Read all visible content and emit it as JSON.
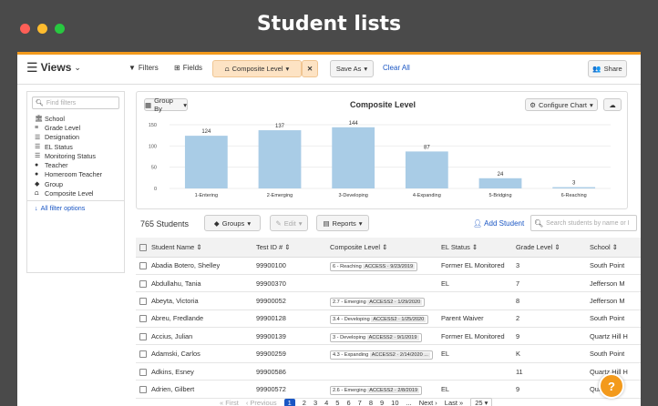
{
  "window": {
    "title": "Student lists",
    "dots": [
      "#ff5f57",
      "#febc2e",
      "#28c840"
    ],
    "accent": "#f39a1c"
  },
  "toolbar": {
    "views_label": "Views",
    "filters_label": "Filters",
    "fields_label": "Fields",
    "active_filter_label": "Composite Level",
    "save_as_label": "Save As",
    "clear_all_label": "Clear All",
    "share_label": "Share"
  },
  "sidebar": {
    "search_placeholder": "Find filters",
    "items": [
      {
        "label": "School",
        "icon": "building-icon"
      },
      {
        "label": "Grade Level",
        "icon": "bars-icon"
      },
      {
        "label": "Designation",
        "icon": "list-icon"
      },
      {
        "label": "EL Status",
        "icon": "list-icon"
      },
      {
        "label": "Monitoring Status",
        "icon": "list-icon"
      },
      {
        "label": "Teacher",
        "icon": "person-icon"
      },
      {
        "label": "Homeroom Teacher",
        "icon": "person-icon"
      },
      {
        "label": "Group",
        "icon": "tag-icon"
      },
      {
        "label": "Composite Level",
        "icon": "chart-icon"
      }
    ],
    "all_filters_label": "All filter options"
  },
  "chart_panel": {
    "group_by_label": "Group By",
    "configure_label": "Configure Chart"
  },
  "chart_data": {
    "type": "bar",
    "title": "Composite Level",
    "categories": [
      "1-Entering",
      "2-Emerging",
      "3-Developing",
      "4-Expanding",
      "5-Bridging",
      "6-Reaching"
    ],
    "values": [
      124,
      137,
      144,
      87,
      24,
      3
    ],
    "ylim": [
      0,
      150
    ],
    "yticks": [
      0,
      50,
      100,
      150
    ],
    "bar_color": "#a9cce6",
    "grid": true,
    "xlabel": "",
    "ylabel": ""
  },
  "list": {
    "count_label": "765 Students",
    "groups_label": "Groups",
    "edit_label": "Edit",
    "reports_label": "Reports",
    "add_student_label": "Add Student",
    "search_placeholder": "Search students by name or I",
    "columns": [
      "Student Name",
      "Test ID #",
      "Composite Level",
      "EL Status",
      "Grade Level",
      "School"
    ],
    "rows": [
      {
        "name": "Abadia Botero, Shelley",
        "test_id": "99900100",
        "level": "6 - Reaching",
        "access": "ACCESS · 9/23/2019",
        "el": "Former EL Monitored",
        "grade": "3",
        "school": "South Point"
      },
      {
        "name": "Abdullahu, Tania",
        "test_id": "99900370",
        "level": "",
        "access": "",
        "el": "EL",
        "grade": "7",
        "school": "Jefferson M"
      },
      {
        "name": "Abeyta, Victoria",
        "test_id": "99900052",
        "level": "2.7 - Emerging",
        "access": "ACCESS2 · 1/29/2020",
        "el": "",
        "grade": "8",
        "school": "Jefferson M"
      },
      {
        "name": "Abreu, Fredlande",
        "test_id": "99900128",
        "level": "3.4 - Developing",
        "access": "ACCESS2 · 1/25/2020",
        "el": "Parent Waiver",
        "grade": "2",
        "school": "South Point"
      },
      {
        "name": "Accius, Julian",
        "test_id": "99900139",
        "level": "3 - Developing",
        "access": "ACCESS2 · 9/1/2019",
        "el": "Former EL Monitored",
        "grade": "9",
        "school": "Quartz Hill H"
      },
      {
        "name": "Adamski, Carlos",
        "test_id": "99900259",
        "level": "4.3 - Expanding",
        "access": "ACCESS2 · 2/14/2020 ...",
        "el": "EL",
        "grade": "K",
        "school": "South Point"
      },
      {
        "name": "Adkins, Esney",
        "test_id": "99900586",
        "level": "",
        "access": "",
        "el": "",
        "grade": "11",
        "school": "Quartz Hill H"
      },
      {
        "name": "Adrien, Gilbert",
        "test_id": "99900572",
        "level": "2.6 - Emerging",
        "access": "ACCESS2 · 2/8/2019",
        "el": "EL",
        "grade": "9",
        "school": "Quartz Hill"
      }
    ]
  },
  "pager": {
    "first": "« First",
    "previous": "‹ Previous",
    "pages": [
      "1",
      "2",
      "3",
      "4",
      "5",
      "6",
      "7",
      "8",
      "9",
      "10"
    ],
    "ellipsis": "...",
    "next": "Next ›",
    "last": "Last »",
    "page_size": "25"
  }
}
